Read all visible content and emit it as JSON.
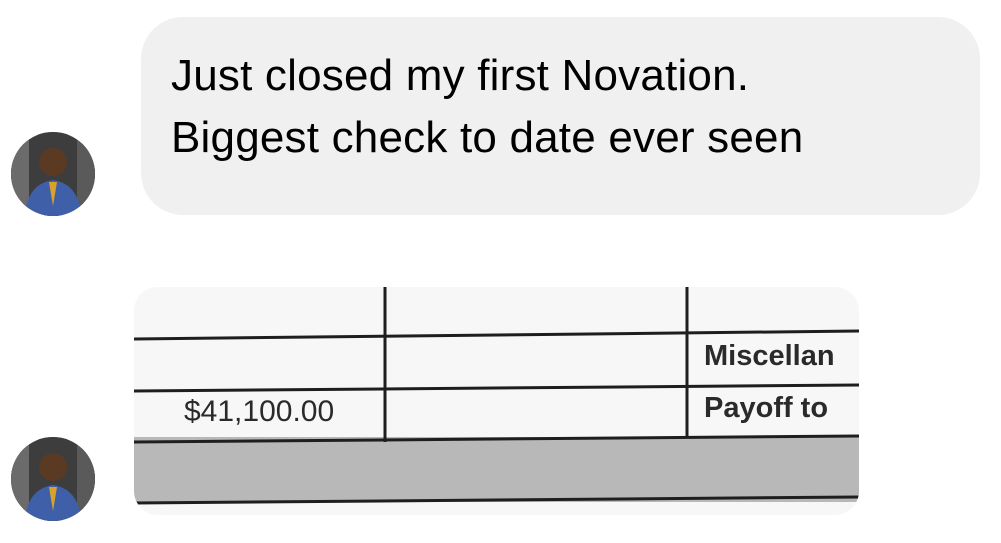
{
  "message": {
    "lines": [
      "Just closed my first Novation.",
      "Biggest check to date ever seen"
    ]
  },
  "attachment": {
    "cells": {
      "amount": "$41,100.00",
      "misc": "Miscellan",
      "payoff": "Payoff to"
    }
  },
  "colors": {
    "bubble": "#f0f0f0",
    "text": "#000000"
  }
}
